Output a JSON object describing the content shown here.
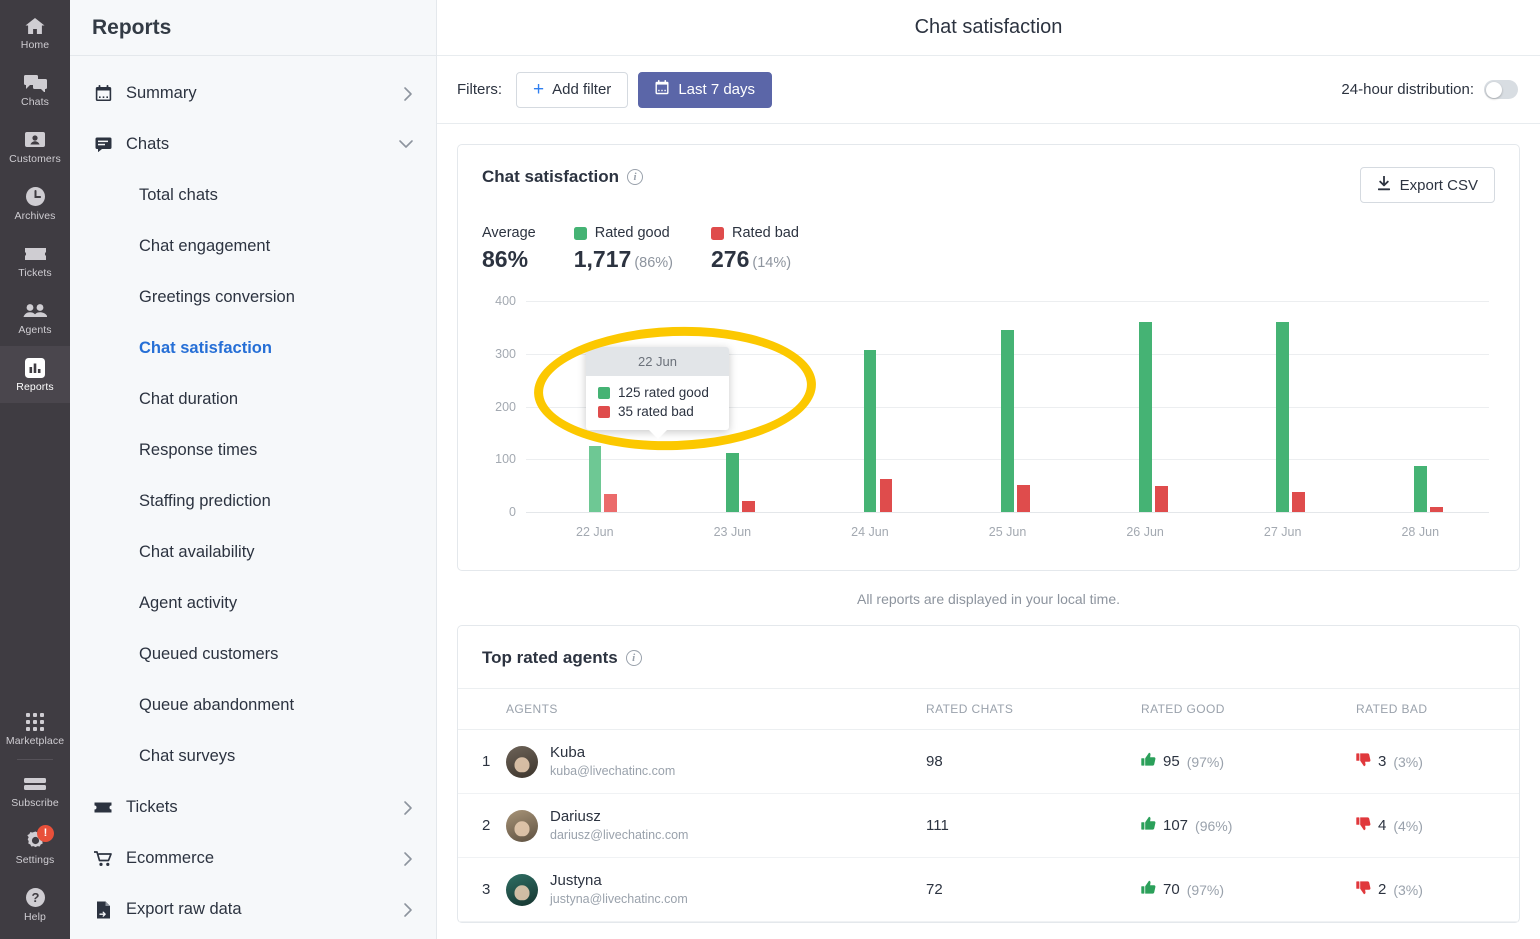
{
  "rail": {
    "top_items": [
      {
        "label": "Home",
        "icon": "home-icon"
      },
      {
        "label": "Chats",
        "icon": "chats-icon"
      },
      {
        "label": "Customers",
        "icon": "customers-icon"
      },
      {
        "label": "Archives",
        "icon": "archives-icon"
      },
      {
        "label": "Tickets",
        "icon": "tickets-icon"
      },
      {
        "label": "Agents",
        "icon": "agents-icon"
      },
      {
        "label": "Reports",
        "icon": "reports-icon",
        "active": true
      }
    ],
    "bottom_items": [
      {
        "label": "Marketplace",
        "icon": "marketplace-icon"
      },
      {
        "label": "Subscribe",
        "icon": "subscribe-icon"
      },
      {
        "label": "Settings",
        "icon": "settings-icon",
        "badge": "!"
      },
      {
        "label": "Help",
        "icon": "help-icon"
      }
    ]
  },
  "nav": {
    "title": "Reports",
    "items": [
      {
        "label": "Summary",
        "icon": "calendar-icon",
        "chevron": "right"
      },
      {
        "label": "Chats",
        "icon": "chat-bubble-icon",
        "chevron": "down"
      }
    ],
    "sub_items": [
      {
        "label": "Total chats"
      },
      {
        "label": "Chat engagement"
      },
      {
        "label": "Greetings conversion"
      },
      {
        "label": "Chat satisfaction",
        "selected": true
      },
      {
        "label": "Chat duration"
      },
      {
        "label": "Response times"
      },
      {
        "label": "Staffing prediction"
      },
      {
        "label": "Chat availability"
      },
      {
        "label": "Agent activity"
      },
      {
        "label": "Queued customers"
      },
      {
        "label": "Queue abandonment"
      },
      {
        "label": "Chat surveys"
      }
    ],
    "trailing_items": [
      {
        "label": "Tickets",
        "icon": "ticket-icon",
        "chevron": "right"
      },
      {
        "label": "Ecommerce",
        "icon": "cart-icon",
        "chevron": "right"
      },
      {
        "label": "Export raw data",
        "icon": "file-export-icon",
        "chevron": "right"
      }
    ]
  },
  "header": {
    "title": "Chat satisfaction"
  },
  "filterbar": {
    "filters_label": "Filters:",
    "add_filter_label": "Add filter",
    "date_range_label": "Last 7 days",
    "distribution_label": "24-hour distribution:",
    "distribution_on": false
  },
  "chart_card": {
    "title": "Chat satisfaction",
    "export_label": "Export CSV",
    "stats": [
      {
        "name": "Average",
        "value": "86%",
        "pct": "",
        "color": ""
      },
      {
        "name": "Rated good",
        "value": "1,717",
        "pct": "(86%)",
        "color": "#45b374"
      },
      {
        "name": "Rated bad",
        "value": "276",
        "pct": "(14%)",
        "color": "#df4c4c"
      }
    ],
    "tooltip": {
      "date": "22 Jun",
      "rows": [
        {
          "text": "125 rated good",
          "color": "#45b374"
        },
        {
          "text": "35 rated bad",
          "color": "#df4c4c"
        }
      ]
    }
  },
  "chart_data": {
    "type": "bar",
    "title": "Chat satisfaction",
    "xlabel": "",
    "ylabel": "",
    "ylim": [
      0,
      400
    ],
    "yticks": [
      0,
      100,
      200,
      300,
      400
    ],
    "grid": true,
    "legend_position": "top-left",
    "categories": [
      "22 Jun",
      "23 Jun",
      "24 Jun",
      "25 Jun",
      "26 Jun",
      "27 Jun",
      "28 Jun"
    ],
    "series": [
      {
        "name": "Rated good",
        "color": "#45b374",
        "values": [
          125,
          112,
          307,
          345,
          360,
          360,
          88
        ]
      },
      {
        "name": "Rated bad",
        "color": "#df4c4c",
        "values": [
          35,
          20,
          62,
          52,
          50,
          38,
          10
        ]
      }
    ],
    "highlighted_category": "22 Jun",
    "annotation": "yellow ellipse highlighting the 22 Jun tooltip"
  },
  "local_time_note": "All reports are displayed in your local time.",
  "agents_card": {
    "title": "Top rated agents",
    "columns": [
      "",
      "AGENTS",
      "RATED CHATS",
      "RATED GOOD",
      "RATED BAD"
    ],
    "rows": [
      {
        "rank": "1",
        "name": "Kuba",
        "email": "kuba@livechatinc.com",
        "rated_chats": "98",
        "good": "95",
        "good_pct": "(97%)",
        "bad": "3",
        "bad_pct": "(3%)"
      },
      {
        "rank": "2",
        "name": "Dariusz",
        "email": "dariusz@livechatinc.com",
        "rated_chats": "111",
        "good": "107",
        "good_pct": "(96%)",
        "bad": "4",
        "bad_pct": "(4%)"
      },
      {
        "rank": "3",
        "name": "Justyna",
        "email": "justyna@livechatinc.com",
        "rated_chats": "72",
        "good": "70",
        "good_pct": "(97%)",
        "bad": "2",
        "bad_pct": "(3%)"
      }
    ]
  },
  "colors": {
    "good": "#45b374",
    "bad": "#df4c4c",
    "accent_blue": "#266fd6",
    "date_button": "#5b66a8",
    "annotation_yellow": "#fcc800",
    "rail_bg": "#3f3c42",
    "nav_bg": "#f6f8fa"
  }
}
